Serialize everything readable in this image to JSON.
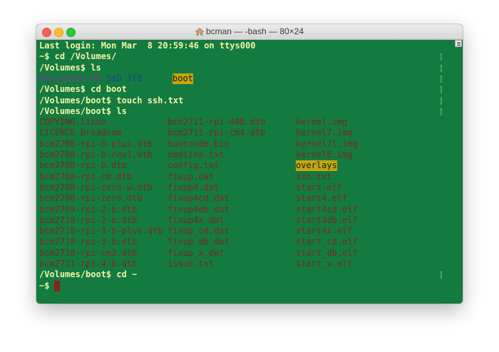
{
  "window": {
    "title": "bcman — -bash — 80×24",
    "home_icon": "house-icon"
  },
  "terminal": {
    "login": "Last login: Mon Mar  8 20:59:46 on ttys000",
    "cmd1": "~$ cd /Volumes/",
    "cmd2": "/Volumes$ ls",
    "volumes": [
      "Macintosh HD",
      "SsD 1tB",
      "boot"
    ],
    "cmd3": "/Volumes$ cd boot",
    "cmd4": "/Volumes/boot$ touch ssh.txt",
    "cmd5": "/Volumes/boot$ ls",
    "files_col1": [
      "COPYING.linux",
      "LICENCE.broadcom",
      "bcm2708-rpi-b-plus.dtb",
      "bcm2708-rpi-b-rev1.dtb",
      "bcm2708-rpi-b.dtb",
      "bcm2708-rpi-cm.dtb",
      "bcm2708-rpi-zero-w.dtb",
      "bcm2708-rpi-zero.dtb",
      "bcm2709-rpi-2-b.dtb",
      "bcm2710-rpi-2-b.dtb",
      "bcm2710-rpi-3-b-plus.dtb",
      "bcm2710-rpi-3-b.dtb",
      "bcm2710-rpi-cm3.dtb",
      "bcm2711-rpi-4-b.dtb"
    ],
    "files_col2": [
      "bcm2711-rpi-400.dtb",
      "bcm2711-rpi-cm4.dtb",
      "bootcode.bin",
      "cmdline.txt",
      "config.txt",
      "fixup.dat",
      "fixup4.dat",
      "fixup4cd.dat",
      "fixup4db.dat",
      "fixup4x.dat",
      "fixup_cd.dat",
      "fixup_db.dat",
      "fixup_x.dat",
      "issue.txt"
    ],
    "files_col3": [
      "kernel.img",
      "kernel7.img",
      "kernel7l.img",
      "kernel8.img",
      "overlays",
      "ssh.txt",
      "start.elf",
      "start4.elf",
      "start4cd.elf",
      "start4db.elf",
      "start4x.elf",
      "start_cd.elf",
      "start_db.elf",
      "start_x.elf"
    ],
    "cmd6": "/Volumes/boot$ cd ~",
    "prompt": "~$ "
  },
  "colors": {
    "background": "#137a40",
    "prompt_text": "#f4f4a8",
    "file_text": "#7a2a1c",
    "highlight": "#c5a70e"
  }
}
